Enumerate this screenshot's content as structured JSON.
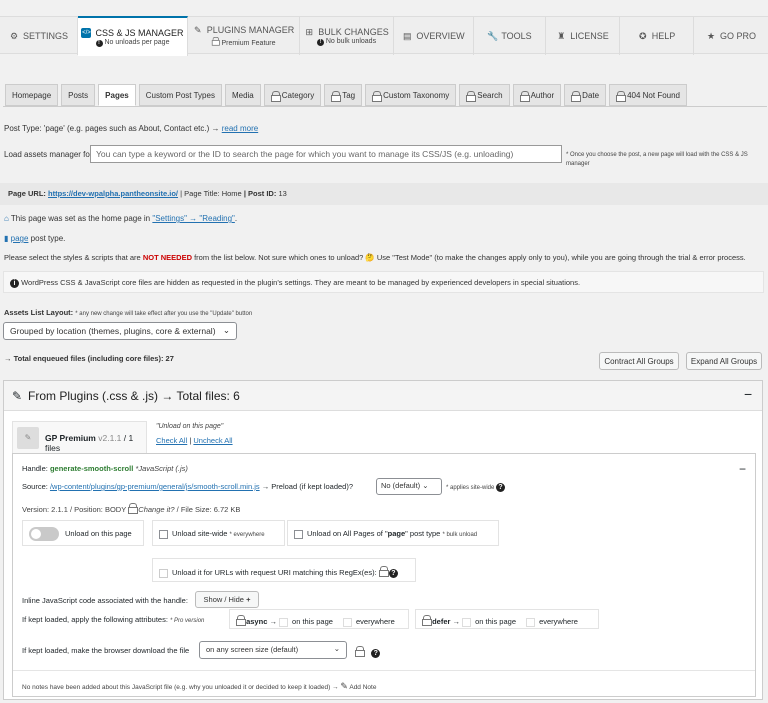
{
  "top_tabs": [
    {
      "label": "SETTINGS",
      "sub": "",
      "icon": "gear-icon",
      "active": false
    },
    {
      "label": "CSS & JS MANAGER",
      "sub": "No unloads per page",
      "icon": "code-icon",
      "active": true
    },
    {
      "label": "PLUGINS MANAGER",
      "sub": "Premium Feature",
      "icon": "plug-icon",
      "active": false
    },
    {
      "label": "BULK CHANGES",
      "sub": "No bulk unloads",
      "icon": "network-icon",
      "active": false
    },
    {
      "label": "OVERVIEW",
      "sub": "",
      "icon": "document-icon",
      "active": false
    },
    {
      "label": "TOOLS",
      "sub": "",
      "icon": "wrench-icon",
      "active": false
    },
    {
      "label": "LICENSE",
      "sub": "",
      "icon": "user-lock-icon",
      "active": false
    },
    {
      "label": "HELP",
      "sub": "",
      "icon": "lifebuoy-icon",
      "active": false
    },
    {
      "label": "GO PRO",
      "sub": "",
      "icon": "star-icon",
      "active": false
    }
  ],
  "sub_tabs": [
    {
      "label": "Homepage",
      "locked": false,
      "active": false
    },
    {
      "label": "Posts",
      "locked": false,
      "active": false
    },
    {
      "label": "Pages",
      "locked": false,
      "active": true
    },
    {
      "label": "Custom Post Types",
      "locked": false,
      "active": false
    },
    {
      "label": "Media",
      "locked": false,
      "active": false
    },
    {
      "label": "Category",
      "locked": true,
      "active": false
    },
    {
      "label": "Tag",
      "locked": true,
      "active": false
    },
    {
      "label": "Custom Taxonomy",
      "locked": true,
      "active": false
    },
    {
      "label": "Search",
      "locked": true,
      "active": false
    },
    {
      "label": "Author",
      "locked": true,
      "active": false
    },
    {
      "label": "Date",
      "locked": true,
      "active": false
    },
    {
      "label": "404 Not Found",
      "locked": true,
      "active": false
    }
  ],
  "post_type_line": {
    "text": "Post Type: 'page' (e.g. pages such as About, Contact etc.) →",
    "link": "read more"
  },
  "load_assets": {
    "label": "Load assets manager for:",
    "placeholder": "You can type a keyword or the ID to search the page for which you want to manage its CSS/JS (e.g. unloading)",
    "note": "* Once you choose the post, a new page will load with the CSS & JS manager"
  },
  "page_info": {
    "url_label": "Page URL:",
    "url": "https://dev-wpalpha.pantheonsite.io/",
    "title_label": "| Page Title:",
    "title": "Home",
    "id_label": "| Post ID:",
    "id": "13"
  },
  "home_note": {
    "text": "This page was set as the home page in",
    "link": "\"Settings\" → \"Reading\"",
    "tail": "."
  },
  "page_type": {
    "link": "page",
    "text": "post type."
  },
  "instructions": {
    "pre": "Please select the styles & scripts that are",
    "highlight": "NOT NEEDED",
    "post": "from the list below. Not sure which ones to unload? 🤔 Use \"Test Mode\" (to make the changes apply only to you), while you are going through the trial & error process."
  },
  "core_notice": "WordPress CSS & JavaScript core files are hidden as requested in the plugin's settings. They are meant to be managed by experienced developers in special situations.",
  "assets_layout": {
    "label": "Assets List Layout:",
    "note": "* any new change will take effect after you use the \"Update\" button",
    "selected": "Grouped by location (themes, plugins, core & external)"
  },
  "total": "→ Total enqueued files (including core files): 27",
  "buttons": {
    "contract": "Contract All Groups",
    "expand": "Expand All Groups"
  },
  "group": {
    "title": "From Plugins (.css & .js) → Total files: 6",
    "collapse": "−"
  },
  "plugin": {
    "name": "GP Premium",
    "version": "v2.1.1",
    "files": "/ 1 files",
    "unload_label": "\"Unload on this page\"",
    "check_all": "Check All",
    "uncheck_all": "Uncheck All"
  },
  "asset": {
    "handle_label": "Handle:",
    "handle": "generate-smooth-scroll",
    "type": "*JavaScript (.js)",
    "source_label": "Source:",
    "source": "/wp-content/plugins/gp-premium/general/js/smooth-scroll.min.js",
    "preload_label": "→ Preload (if kept loaded)?",
    "preload_value": "No (default)",
    "preload_note": "* applies site-wide",
    "version_line": "Version: 2.1.1 / Position: BODY",
    "change_it": "Change it?",
    "filesize": "/ File Size: 6.72 KB",
    "unload_page": "Unload on this page",
    "unload_site": "Unload site-wide",
    "unload_site_note": "* everywhere",
    "unload_all_pre": "Unload on All Pages of \"",
    "unload_all_bold": "page",
    "unload_all_post": "\" post type",
    "unload_all_note": "* bulk unload",
    "regex": "Unload it for URLs with request URI matching this RegEx(es):",
    "inline_label": "Inline JavaScript code associated with the handle:",
    "show_hide": "Show / Hide",
    "attrs_label": "If kept loaded, apply the following attributes:",
    "attrs_note": "* Pro version",
    "async": "async →",
    "defer": "defer →",
    "on_this_page": "on this page",
    "everywhere": "everywhere",
    "download_label": "If kept loaded, make the browser download the file",
    "download_value": "on any screen size (default)",
    "notes": "No notes have been added about this JavaScript file (e.g. why you unloaded it or decided to keep it loaded) →",
    "add_note": "Add Note",
    "collapse": "−"
  }
}
